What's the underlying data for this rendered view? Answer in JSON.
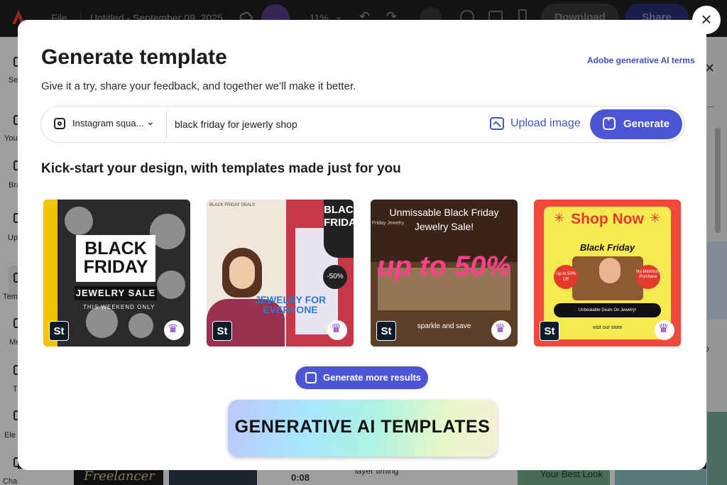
{
  "background": {
    "topbar": {
      "file_menu": "File",
      "document_title": "Untitled - September 09, 2025",
      "zoom": "11%",
      "download": "Download",
      "share": "Share"
    },
    "left_rail": [
      "Se",
      "You",
      "Bra",
      "Up",
      "Tem",
      "Me",
      "T",
      "Ele",
      "Charts and"
    ],
    "right_panel_char": "o",
    "bottom": {
      "thumb1_text": "Freelancer",
      "time": "0:08",
      "layer_text": "layer timing",
      "thumb3_text": "Your Best Look"
    }
  },
  "modal": {
    "close_label": "×",
    "title": "Generate template",
    "terms_link": "Adobe generative AI terms",
    "subtitle": "Give it a try, share your feedback, and together we’ll make it better.",
    "prompt": {
      "format_label": "Instagram squa...",
      "input_value": "black friday for jewerly shop",
      "upload_label": "Upload image",
      "generate_label": "Generate"
    },
    "section_heading": "Kick-start your design, with templates made just for you",
    "templates": [
      {
        "badge": "St",
        "headline": "BLACK FRIDAY",
        "ribbon": "JEWELRY SALE",
        "small": "THIS WEEKEND ONLY"
      },
      {
        "badge": "St",
        "mini": "BLACK FRIDAY DEALS",
        "sign": "BLACK FRIDAY",
        "discount": "-50%",
        "headline": "JEWELRY FOR EVERYONE"
      },
      {
        "badge": "St",
        "headline": "Unmissable Black Friday Jewelry Sale!",
        "big": "up to 50%",
        "footer": "sparkle and save",
        "side": "Friday Jewelry"
      },
      {
        "badge": "St",
        "headline": "Shop Now",
        "sub": "Black Friday",
        "dot1": "Up to 50% Off",
        "dot2": "No Minimum Purchase",
        "pill": "Unbeatable Deals On Jewelry!",
        "footer": "visit our store"
      }
    ],
    "more_results_label": "Generate more results",
    "banner_text": "GENERATIVE AI TEMPLATES"
  },
  "colors": {
    "accent": "#4b55d6",
    "link": "#3d4fc0",
    "premium_crown": "#8a3fd1",
    "template4_bg": "#f04a3c",
    "template4_panel": "#f6ea52"
  }
}
